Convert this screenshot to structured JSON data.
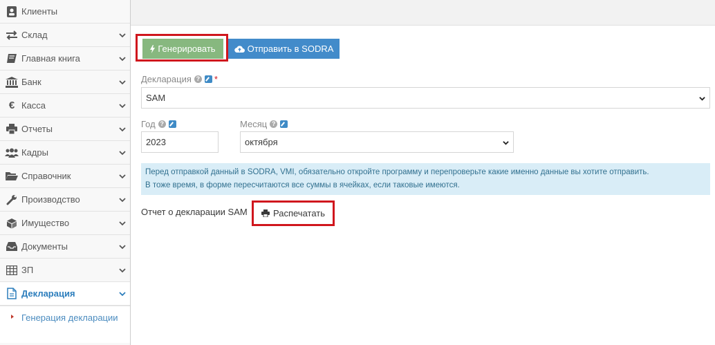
{
  "sidebar": {
    "items": [
      {
        "label": "Клиенты",
        "icon": "contact-card-icon"
      },
      {
        "label": "Склад",
        "icon": "exchange-arrows-icon"
      },
      {
        "label": "Главная книга",
        "icon": "book-icon"
      },
      {
        "label": "Банк",
        "icon": "bank-icon"
      },
      {
        "label": "Касса",
        "icon": "euro-icon"
      },
      {
        "label": "Отчеты",
        "icon": "print-icon"
      },
      {
        "label": "Кадры",
        "icon": "users-icon"
      },
      {
        "label": "Справочник",
        "icon": "folder-open-icon"
      },
      {
        "label": "Производство",
        "icon": "wrench-icon"
      },
      {
        "label": "Имущество",
        "icon": "cube-icon"
      },
      {
        "label": "Документы",
        "icon": "inbox-icon"
      },
      {
        "label": "ЗП",
        "icon": "table-icon"
      },
      {
        "label": "Декларация",
        "icon": "document-icon"
      }
    ],
    "submenu": {
      "label": "Генерация декларации"
    }
  },
  "toolbar": {
    "generate_label": "Генерировать",
    "send_label": "Отправить в SODRA"
  },
  "form": {
    "declaration_label": "Декларация",
    "declaration_value": "SAM",
    "year_label": "Год",
    "year_value": "2023",
    "month_label": "Месяц",
    "month_value": "октября"
  },
  "info": {
    "line1": "Перед отправкой данный в SODRA, VMI, обязательно откройте программу и перепроверьте какие именно данные вы хотите отправить.",
    "line2": "В тоже время, в форме пересчитаются все суммы в ячейках, если таковые имеются."
  },
  "report": {
    "label": "Отчет о декларации SAM",
    "print_label": "Распечатать"
  },
  "colors": {
    "green_button": "#87b87f",
    "blue_button": "#428bca",
    "highlight": "#d0161d",
    "active_nav": "#2b7dbc",
    "info_bg": "#d9edf7"
  }
}
